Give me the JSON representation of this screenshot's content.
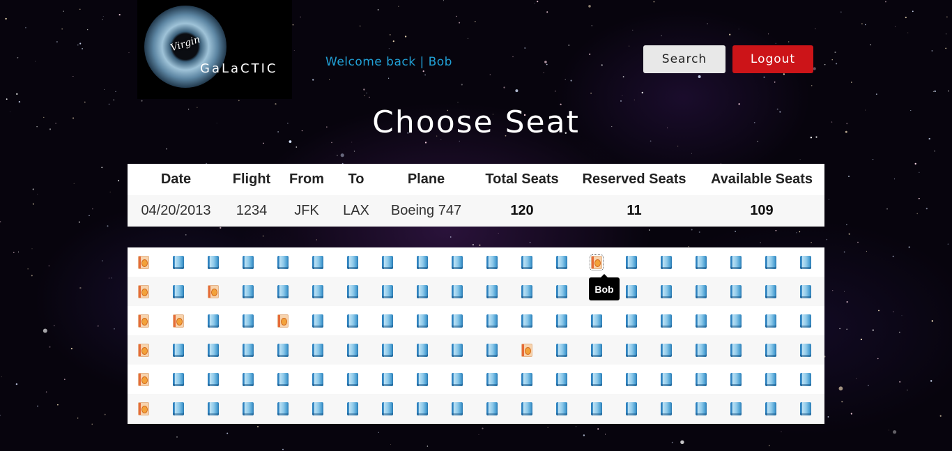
{
  "brand": {
    "logo_mark": "Virgin",
    "logo_text": "GaLaCTIC"
  },
  "header": {
    "welcome_text": "Welcome back | Bob",
    "search_label": "Search",
    "logout_label": "Logout",
    "accent_color": "#21a0d6",
    "logout_color": "#cc1418"
  },
  "page": {
    "title": "Choose Seat"
  },
  "flight_info": {
    "headers": [
      "Date",
      "Flight",
      "From",
      "To",
      "Plane",
      "Total Seats",
      "Reserved Seats",
      "Available Seats"
    ],
    "values": [
      "04/20/2013",
      "1234",
      "JFK",
      "LAX",
      "Boeing 747",
      "120",
      "11",
      "109"
    ]
  },
  "seat_map": {
    "columns": 20,
    "legend": {
      "available": "seat-available-icon",
      "reserved": "seat-reserved-icon"
    },
    "rows": [
      [
        "R",
        "A",
        "A",
        "A",
        "A",
        "A",
        "A",
        "A",
        "A",
        "A",
        "A",
        "A",
        "A",
        "R",
        "A",
        "A",
        "A",
        "A",
        "A",
        "A"
      ],
      [
        "R",
        "A",
        "R",
        "A",
        "A",
        "A",
        "A",
        "A",
        "A",
        "A",
        "A",
        "A",
        "A",
        "A",
        "A",
        "A",
        "A",
        "A",
        "A",
        "A"
      ],
      [
        "R",
        "R",
        "A",
        "A",
        "R",
        "A",
        "A",
        "A",
        "A",
        "A",
        "A",
        "A",
        "A",
        "A",
        "A",
        "A",
        "A",
        "A",
        "A",
        "A"
      ],
      [
        "R",
        "A",
        "A",
        "A",
        "A",
        "A",
        "A",
        "A",
        "A",
        "A",
        "A",
        "R",
        "A",
        "A",
        "A",
        "A",
        "A",
        "A",
        "A",
        "A"
      ],
      [
        "R",
        "A",
        "A",
        "A",
        "A",
        "A",
        "A",
        "A",
        "A",
        "A",
        "A",
        "A",
        "A",
        "A",
        "A",
        "A",
        "A",
        "A",
        "A",
        "A"
      ],
      [
        "R",
        "A",
        "A",
        "A",
        "A",
        "A",
        "A",
        "A",
        "A",
        "A",
        "A",
        "A",
        "A",
        "A",
        "A",
        "A",
        "A",
        "A",
        "A",
        "A"
      ]
    ],
    "hover_seat": {
      "row": 1,
      "col": 14
    },
    "tooltip_text": "Bob"
  }
}
